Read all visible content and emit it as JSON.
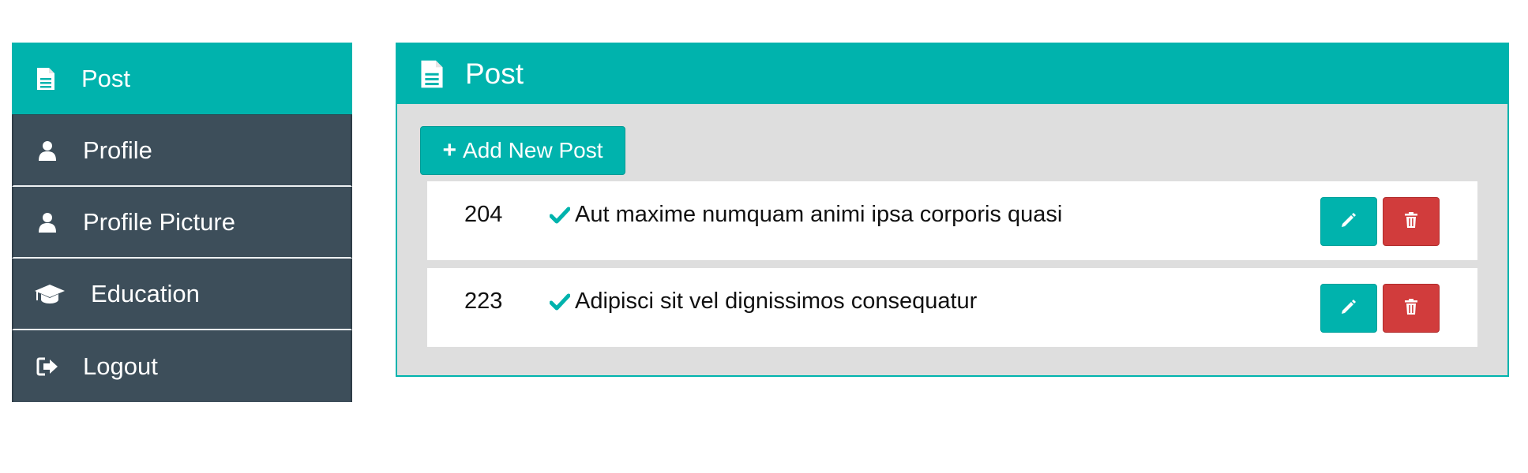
{
  "sidebar": {
    "items": [
      {
        "label": "Post",
        "icon": "file-text-icon",
        "active": true
      },
      {
        "label": "Profile",
        "icon": "user-icon",
        "active": false
      },
      {
        "label": "Profile Picture",
        "icon": "user-icon",
        "active": false
      },
      {
        "label": "Education",
        "icon": "graduation-cap-icon",
        "active": false
      },
      {
        "label": "Logout",
        "icon": "sign-out-icon",
        "active": false
      }
    ]
  },
  "panel": {
    "title": "Post",
    "title_icon": "file-text-icon",
    "add_button_label": "Add New Post",
    "add_button_icon": "plus-icon",
    "posts": [
      {
        "id": "204",
        "title": "Aut maxime numquam animi ipsa corporis quasi",
        "status_icon": "check-icon"
      },
      {
        "id": "223",
        "title": "Adipisci sit vel dignissimos consequatur",
        "status_icon": "check-icon"
      }
    ],
    "edit_icon": "pencil-icon",
    "delete_icon": "trash-icon"
  },
  "colors": {
    "accent": "#00b3ad",
    "sidebar_bg": "#3d4e5a",
    "danger": "#d13c3c",
    "panel_body_bg": "#dedede"
  }
}
